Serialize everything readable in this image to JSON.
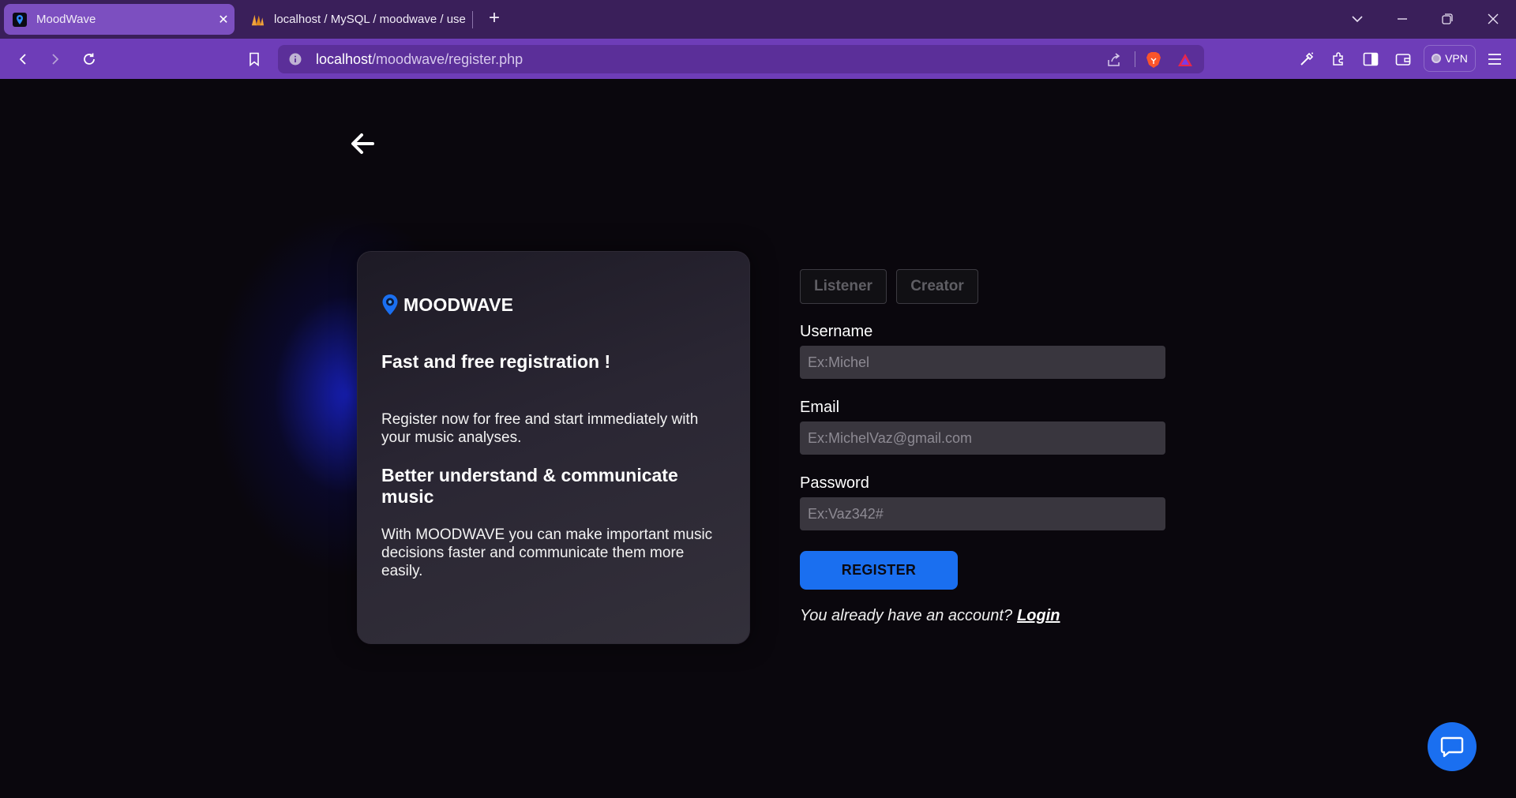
{
  "browser": {
    "tabs": [
      {
        "title": "MoodWave",
        "active": true
      },
      {
        "title": "localhost / MySQL / moodwave / use",
        "active": false
      }
    ],
    "url": {
      "host": "localhost",
      "path": "/moodwave/register.php"
    },
    "vpn_label": "VPN"
  },
  "brand": {
    "name": "MOODWAVE",
    "accent": "#1a6ff0"
  },
  "card": {
    "heading1": "Fast and free registration !",
    "text1": "Register now for free and start immediately with your music analyses.",
    "heading2": "Better understand & communicate music",
    "text2": "With MOODWAVE you can make important music decisions faster and communicate them more easily."
  },
  "form": {
    "roles": [
      "Listener",
      "Creator"
    ],
    "username": {
      "label": "Username",
      "placeholder": "Ex:Michel"
    },
    "email": {
      "label": "Email",
      "placeholder": "Ex:MichelVaz@gmail.com"
    },
    "password": {
      "label": "Password",
      "placeholder": "Ex:Vaz342#"
    },
    "register_label": "REGISTER",
    "login_prompt": "You already have an account?",
    "login_link": "Login"
  },
  "icons": [
    "back-arrow-icon",
    "chat-icon",
    "location-pin-icon",
    "brave-lion-icon"
  ]
}
